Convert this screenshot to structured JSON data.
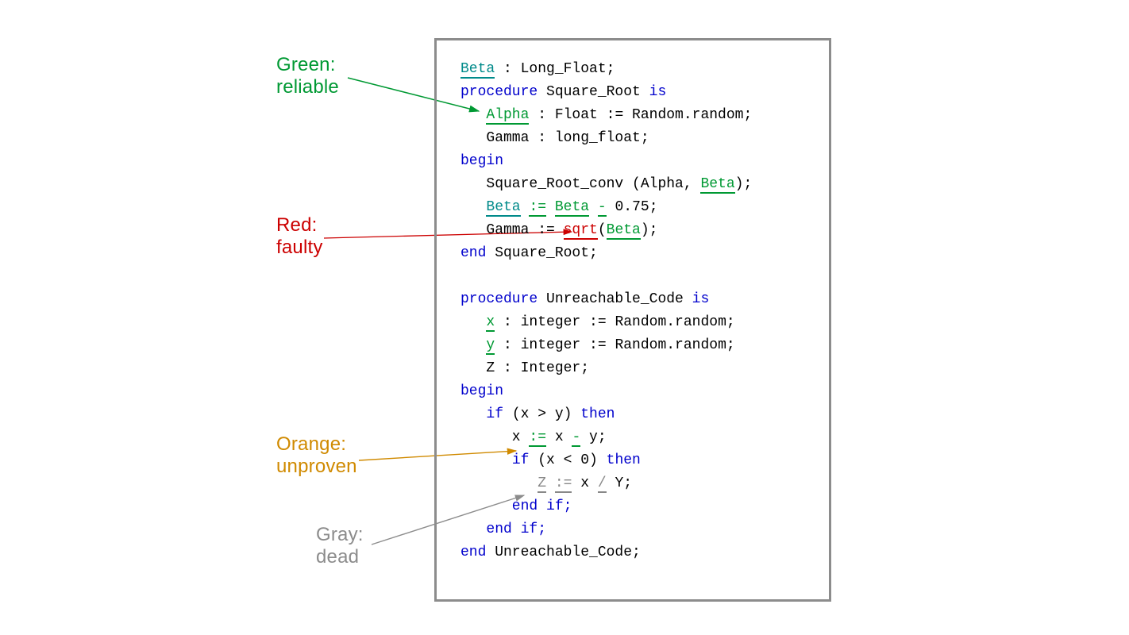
{
  "colors": {
    "green": "#009933",
    "red": "#cc0000",
    "orange": "#d08a00",
    "gray": "#8c8c8c",
    "teal": "#008a8a",
    "keyword": "#0000cc",
    "border": "#8c8c8c"
  },
  "labels": {
    "green": {
      "line1": "Green:",
      "line2": "reliable"
    },
    "red": {
      "line1": "Red:",
      "line2": "faulty"
    },
    "orange": {
      "line1": "Orange:",
      "line2": "unproven"
    },
    "gray": {
      "line1": "Gray:",
      "line2": "dead"
    }
  },
  "code": {
    "tokens": {
      "beta_decl_beta": "Beta",
      "beta_decl_rest": " : Long_Float;",
      "proc_kw": "procedure",
      "proc1_name": " Square_Root ",
      "is_kw": "is",
      "alpha_name": "Alpha",
      "alpha_rest": " : Float := Random.random;",
      "gamma_decl": "   Gamma : long_float;",
      "begin_kw": "begin",
      "call_pre": "   Square_Root_conv (Alpha, ",
      "call_beta": "Beta",
      "call_post": ");",
      "assign_beta1": "Beta",
      "assign_sp": " ",
      "assign_colon_eq": ":=",
      "assign_beta2": "Beta",
      "assign_minus": "-",
      "assign_tail": " 0.75;",
      "gamma_pre": "   Gamma := ",
      "sqrt_tok": "sqrt",
      "gamma_lpar": "(",
      "gamma_beta": "Beta",
      "gamma_rpar": ");",
      "end_kw": "end",
      "end_proc1": " Square_Root;",
      "proc2_name": " Unreachable_Code ",
      "x_tok": "x",
      "x_decl_rest": " : integer := Random.random;",
      "y_tok": "y",
      "y_decl_rest": " : integer := Random.random;",
      "z_decl": "   Z : Integer;",
      "if_kw": "if",
      "if1_cond": " (x > y) ",
      "then_kw": "then",
      "xminus_pre": "      x ",
      "xminus_ce": ":=",
      "xminus_mid": " x ",
      "xminus_minus": "-",
      "xminus_tail": " y;",
      "if2_cond": " (x < 0) ",
      "z_var": "Z",
      "z_sp": " ",
      "z_ce": ":=",
      "z_mid": " x ",
      "z_div": "/",
      "z_tail": " Y;",
      "endif_kw": "      end if;",
      "endif2_kw": "   end if;",
      "end_proc2": " Unreachable_Code;"
    }
  }
}
